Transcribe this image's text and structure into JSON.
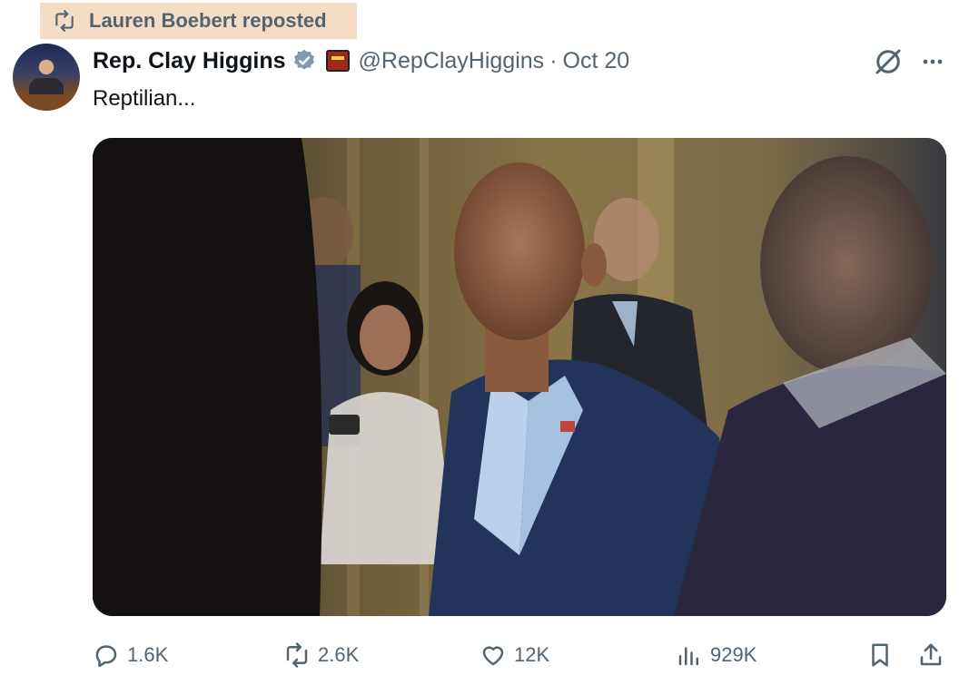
{
  "repost": {
    "label": "Lauren Boebert reposted",
    "icon": "repost-icon",
    "highlight_color": "#f5dcc4"
  },
  "author": {
    "name": "Rep. Clay Higgins",
    "handle": "@RepClayHiggins",
    "separator": "·",
    "date": "Oct 20",
    "verified_color": "#829aab"
  },
  "tweet": {
    "text": "Reptilian..."
  },
  "media": {
    "type": "photo"
  },
  "actions": {
    "replies": "1.6K",
    "reposts": "2.6K",
    "likes": "12K",
    "views": "929K"
  },
  "colors": {
    "text": "#0f1419",
    "secondary": "#536471"
  }
}
